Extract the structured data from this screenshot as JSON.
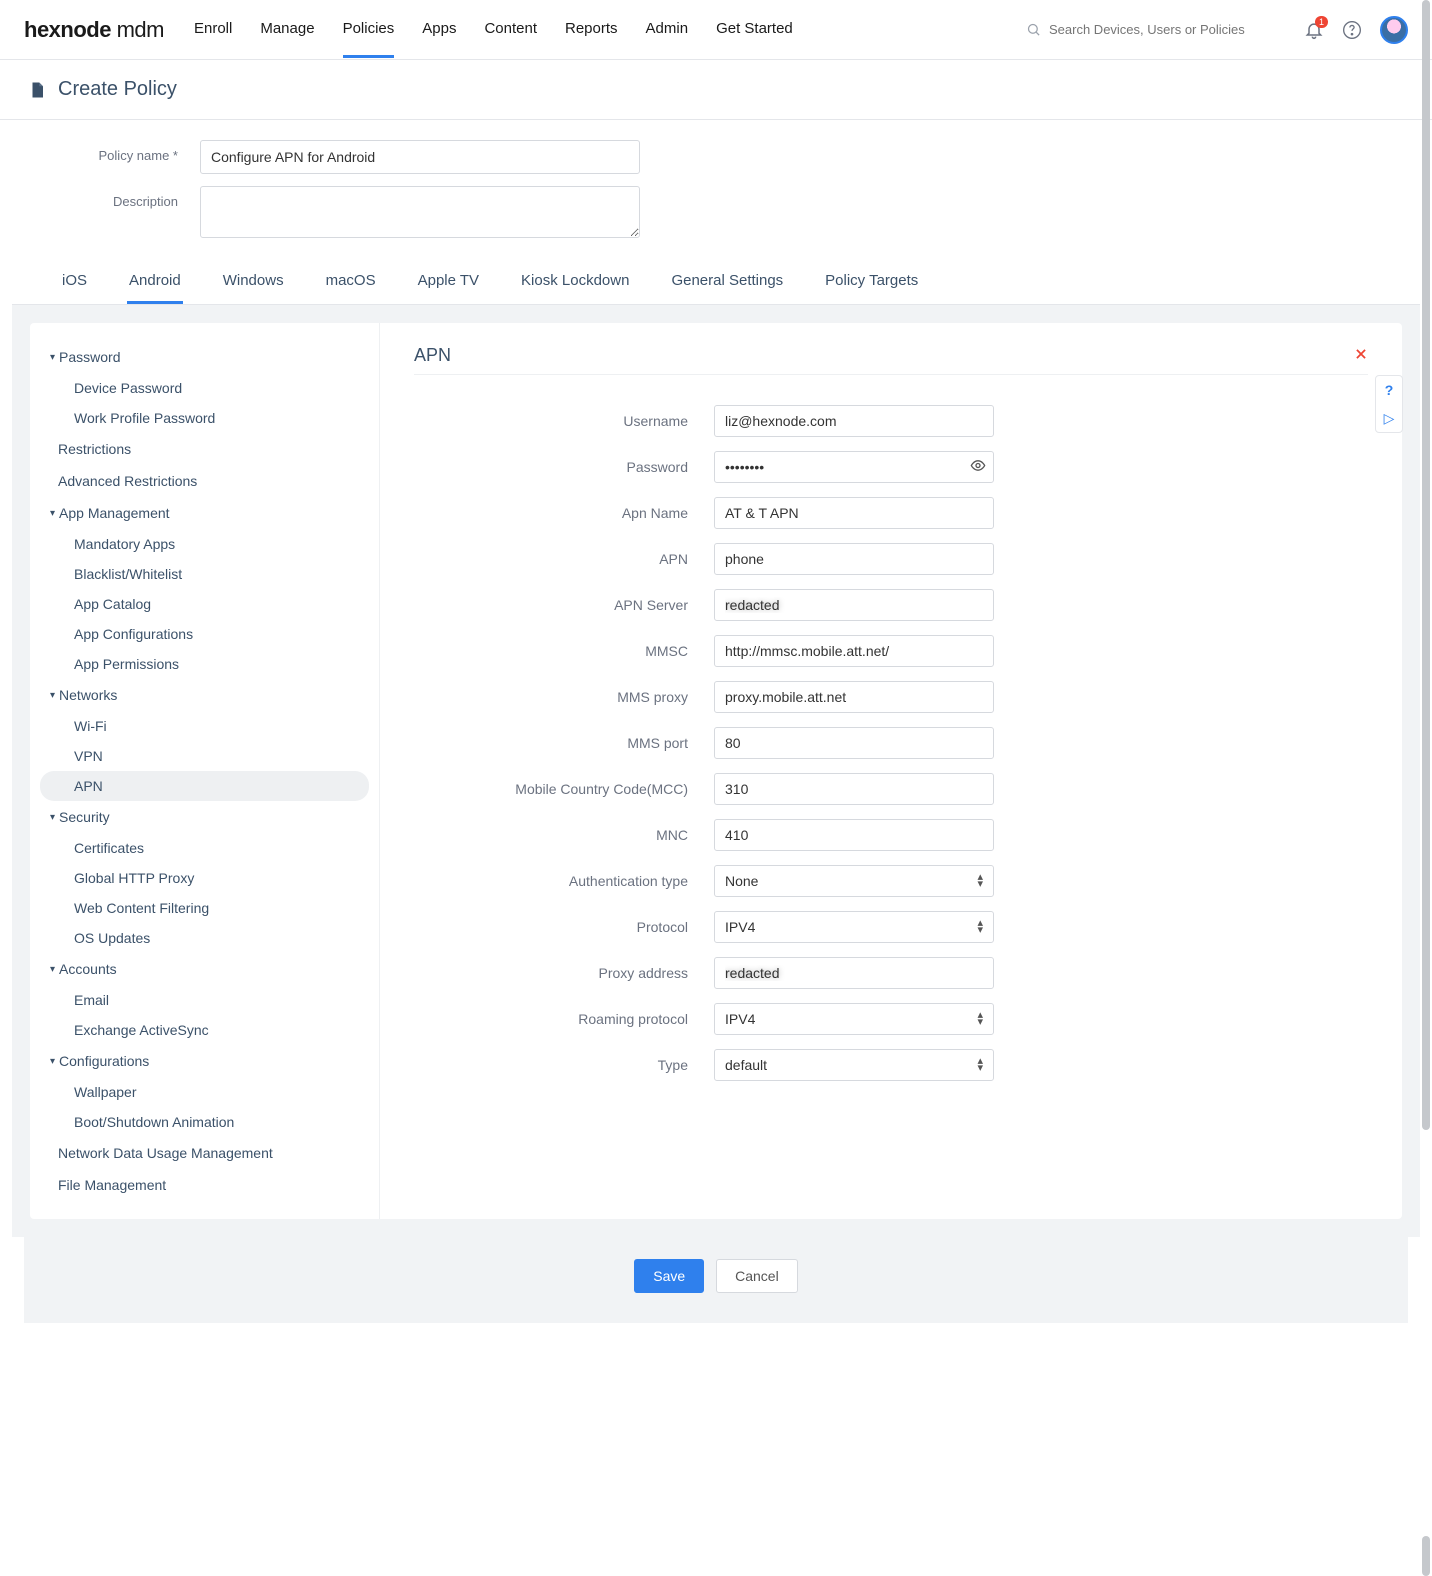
{
  "brand": {
    "name": "hexnode",
    "suffix": "mdm"
  },
  "topnav": [
    "Enroll",
    "Manage",
    "Policies",
    "Apps",
    "Content",
    "Reports",
    "Admin",
    "Get Started"
  ],
  "topnav_active": "Policies",
  "search_placeholder": "Search Devices, Users or Policies",
  "notification_count": "1",
  "page_title": "Create Policy",
  "form": {
    "policy_name_label": "Policy name *",
    "policy_name_value": "Configure APN for Android",
    "description_label": "Description",
    "description_value": ""
  },
  "platform_tabs": [
    "iOS",
    "Android",
    "Windows",
    "macOS",
    "Apple TV",
    "Kiosk Lockdown",
    "General Settings",
    "Policy Targets"
  ],
  "platform_active": "Android",
  "sidebar": [
    {
      "type": "group",
      "label": "Password",
      "items": [
        "Device Password",
        "Work Profile Password"
      ]
    },
    {
      "type": "item",
      "label": "Restrictions"
    },
    {
      "type": "item",
      "label": "Advanced Restrictions"
    },
    {
      "type": "group",
      "label": "App Management",
      "items": [
        "Mandatory Apps",
        "Blacklist/Whitelist",
        "App Catalog",
        "App Configurations",
        "App Permissions"
      ]
    },
    {
      "type": "group",
      "label": "Networks",
      "items": [
        "Wi-Fi",
        "VPN",
        "APN"
      ]
    },
    {
      "type": "group",
      "label": "Security",
      "items": [
        "Certificates",
        "Global HTTP Proxy",
        "Web Content Filtering",
        "OS Updates"
      ]
    },
    {
      "type": "group",
      "label": "Accounts",
      "items": [
        "Email",
        "Exchange ActiveSync"
      ]
    },
    {
      "type": "group",
      "label": "Configurations",
      "items": [
        "Wallpaper",
        "Boot/Shutdown Animation"
      ]
    },
    {
      "type": "item",
      "label": "Network Data Usage Management"
    },
    {
      "type": "item",
      "label": "File Management"
    }
  ],
  "sidebar_active": "APN",
  "panel_title": "APN",
  "fields": [
    {
      "label": "Username",
      "kind": "text",
      "value": "liz@hexnode.com"
    },
    {
      "label": "Password",
      "kind": "password",
      "value": "••••••••"
    },
    {
      "label": "Apn Name",
      "kind": "text",
      "value": "AT & T APN"
    },
    {
      "label": "APN",
      "kind": "text",
      "value": "phone"
    },
    {
      "label": "APN Server",
      "kind": "text",
      "value": "",
      "blur": true
    },
    {
      "label": "MMSC",
      "kind": "text",
      "value": "http://mmsc.mobile.att.net/"
    },
    {
      "label": "MMS proxy",
      "kind": "text",
      "value": "proxy.mobile.att.net"
    },
    {
      "label": "MMS port",
      "kind": "text",
      "value": "80"
    },
    {
      "label": "Mobile Country Code(MCC)",
      "kind": "text",
      "value": "310"
    },
    {
      "label": "MNC",
      "kind": "text",
      "value": "410"
    },
    {
      "label": "Authentication type",
      "kind": "select",
      "value": "None"
    },
    {
      "label": "Protocol",
      "kind": "select",
      "value": "IPV4"
    },
    {
      "label": "Proxy address",
      "kind": "text",
      "value": "",
      "blur": true
    },
    {
      "label": "Roaming protocol",
      "kind": "select",
      "value": "IPV4"
    },
    {
      "label": "Type",
      "kind": "select",
      "value": "default"
    }
  ],
  "buttons": {
    "save": "Save",
    "cancel": "Cancel"
  }
}
